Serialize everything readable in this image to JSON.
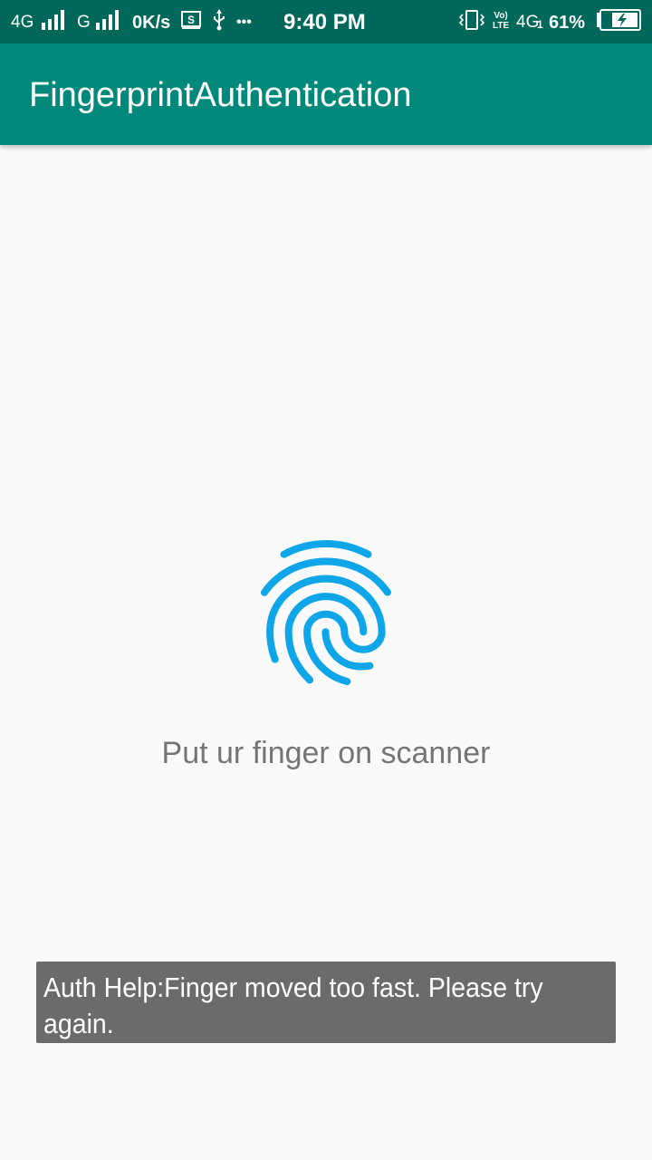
{
  "status_bar": {
    "network1": "4G",
    "network2": "G",
    "speed": "0K/s",
    "time": "9:40 PM",
    "volte_top": "Vo)",
    "volte_bottom": "LTE",
    "network3": "4G",
    "network3_sub": "1",
    "battery": "61%",
    "more_dots": "•••"
  },
  "app_bar": {
    "title": "FingerprintAuthentication",
    "color": "#00897b"
  },
  "main": {
    "fingerprint_icon": "fingerprint-icon",
    "fingerprint_color": "#0ea5e9",
    "prompt": "Put ur finger on scanner"
  },
  "toast": {
    "line1": "Auth Help:Finger moved too fast. Please try",
    "line2": "again."
  }
}
